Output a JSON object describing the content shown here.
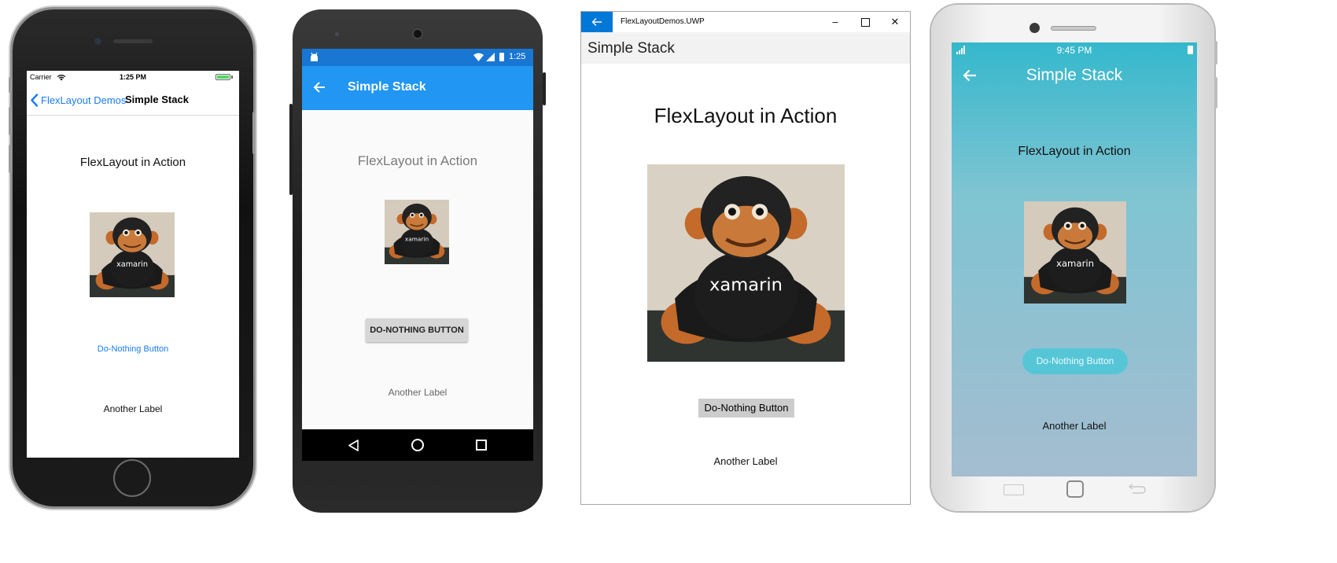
{
  "colors": {
    "ios_accent": "#1a7cf5",
    "android_primary": "#2196f3",
    "android_status": "#1976d2",
    "uwp_accent": "#0078d7",
    "samsung_gradient_top": "#35b8cc",
    "samsung_button": "#56c6d7"
  },
  "ios": {
    "carrier": "Carrier",
    "time": "1:25 PM",
    "back_label": "FlexLayout Demos",
    "page_title": "Simple Stack",
    "heading": "FlexLayout in Action",
    "button_label": "Do-Nothing Button",
    "label": "Another Label",
    "icons": [
      "wifi-icon",
      "battery-icon",
      "chevron-left-icon"
    ]
  },
  "android": {
    "time": "1:25",
    "page_title": "Simple Stack",
    "heading": "FlexLayout in Action",
    "button_label": "DO-NOTHING BUTTON",
    "label": "Another Label",
    "icons": [
      "android-debug-icon",
      "wifi-icon",
      "signal-icon",
      "battery-icon",
      "back-arrow-icon",
      "nav-back-icon",
      "nav-home-icon",
      "nav-recents-icon"
    ]
  },
  "uwp": {
    "window_title": "FlexLayoutDemos.UWP",
    "page_title": "Simple Stack",
    "heading": "FlexLayout in Action",
    "button_label": "Do-Nothing Button",
    "label": "Another Label",
    "icons": [
      "back-arrow-icon",
      "minimize-icon",
      "maximize-icon",
      "close-icon"
    ]
  },
  "samsung": {
    "time": "9:45 PM",
    "page_title": "Simple Stack",
    "heading": "FlexLayout in Action",
    "button_label": "Do-Nothing Button",
    "label": "Another Label",
    "icons": [
      "signal-icon",
      "battery-icon",
      "back-arrow-icon",
      "menu-key-icon",
      "home-key-icon",
      "back-key-icon"
    ]
  }
}
